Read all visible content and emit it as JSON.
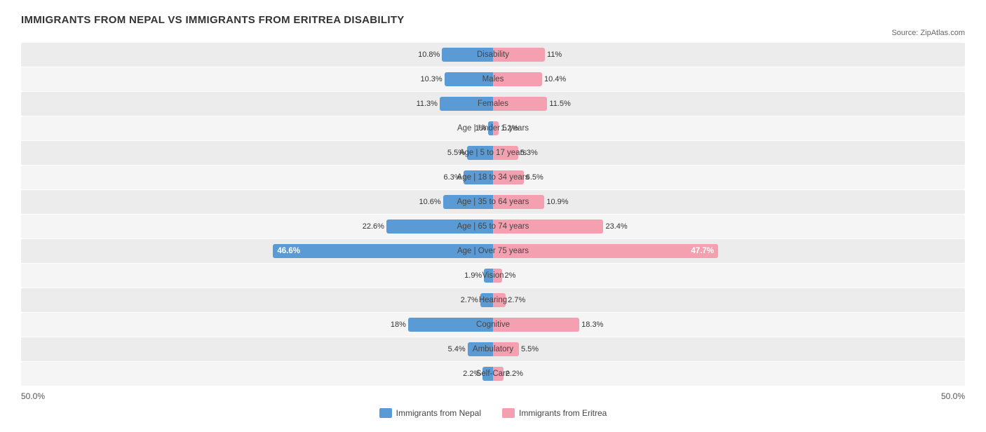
{
  "title": "IMMIGRANTS FROM NEPAL VS IMMIGRANTS FROM ERITREA DISABILITY",
  "source": "Source: ZipAtlas.com",
  "maxPercent": 50,
  "rows": [
    {
      "label": "Disability",
      "nepal": 10.8,
      "eritrea": 11.0
    },
    {
      "label": "Males",
      "nepal": 10.3,
      "eritrea": 10.4
    },
    {
      "label": "Females",
      "nepal": 11.3,
      "eritrea": 11.5
    },
    {
      "label": "Age | Under 5 years",
      "nepal": 1.0,
      "eritrea": 1.2
    },
    {
      "label": "Age | 5 to 17 years",
      "nepal": 5.5,
      "eritrea": 5.3
    },
    {
      "label": "Age | 18 to 34 years",
      "nepal": 6.3,
      "eritrea": 6.5
    },
    {
      "label": "Age | 35 to 64 years",
      "nepal": 10.6,
      "eritrea": 10.9
    },
    {
      "label": "Age | 65 to 74 years",
      "nepal": 22.6,
      "eritrea": 23.4
    },
    {
      "label": "Age | Over 75 years",
      "nepal": 46.6,
      "eritrea": 47.7,
      "large": true
    },
    {
      "label": "Vision",
      "nepal": 1.9,
      "eritrea": 2.0
    },
    {
      "label": "Hearing",
      "nepal": 2.7,
      "eritrea": 2.7
    },
    {
      "label": "Cognitive",
      "nepal": 18.0,
      "eritrea": 18.3
    },
    {
      "label": "Ambulatory",
      "nepal": 5.4,
      "eritrea": 5.5
    },
    {
      "label": "Self-Care",
      "nepal": 2.2,
      "eritrea": 2.2
    }
  ],
  "legend": {
    "nepal": "Immigrants from Nepal",
    "eritrea": "Immigrants from Eritrea"
  },
  "axis": {
    "left": "50.0%",
    "right": "50.0%"
  }
}
